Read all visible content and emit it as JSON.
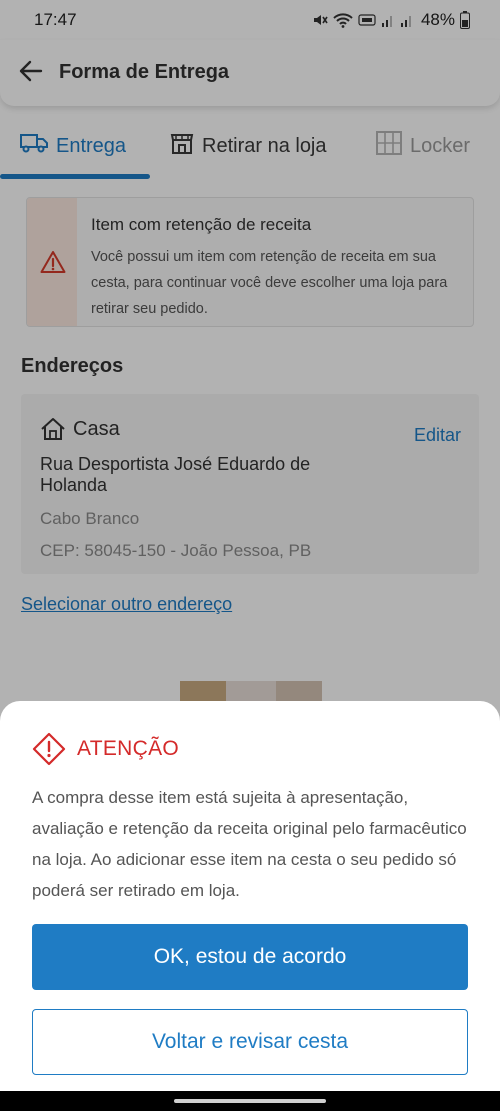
{
  "status_bar": {
    "time": "17:47",
    "battery": "48%",
    "icons": [
      "mute-icon",
      "wifi-icon",
      "volte-icon",
      "signal-icon",
      "signal-icon",
      "battery-icon"
    ]
  },
  "header": {
    "title": "Forma de Entrega",
    "back_icon": "arrow-left-icon"
  },
  "tabs": [
    {
      "label": "Entrega",
      "icon": "truck-icon",
      "state": "active"
    },
    {
      "label": "Retirar na loja",
      "icon": "store-icon",
      "state": "enabled"
    },
    {
      "label": "Locker",
      "icon": "locker-icon",
      "state": "disabled"
    }
  ],
  "warning": {
    "title": "Item com retenção de receita",
    "text": "Você possui um item com retenção de receita em sua cesta, para continuar você deve escolher uma loja para retirar seu pedido.",
    "icon": "warning-triangle-icon"
  },
  "addresses": {
    "section_title": "Endereços",
    "card": {
      "name": "Casa",
      "icon": "home-icon",
      "edit_label": "Editar",
      "street": "Rua Desportista José Eduardo de Holanda",
      "district": "Cabo Branco",
      "cep": "CEP: 58045-150 - João Pessoa, PB"
    },
    "select_other": "Selecionar outro endereço"
  },
  "modal": {
    "title": "ATENÇÃO",
    "icon": "warning-diamond-icon",
    "text": "A compra desse item está sujeita à apresentação, avaliação e retenção da receita original pelo farmacêutico na loja. Ao adicionar esse item na cesta o seu pedido só poderá ser retirado em loja.",
    "primary_button": "OK, estou de acordo",
    "secondary_button": "Voltar e revisar cesta"
  },
  "colors": {
    "accent": "#1f7cc4",
    "danger": "#d42a2a",
    "warning_strip": "#fbe8e0"
  }
}
